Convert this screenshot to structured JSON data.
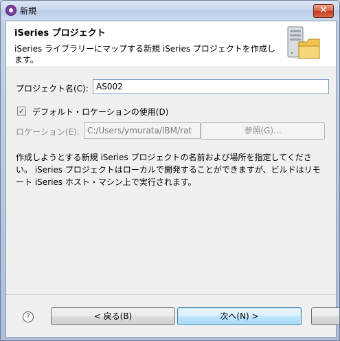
{
  "window": {
    "title": "新規",
    "close_label": "✕"
  },
  "header": {
    "title": "iSeries プロジェクト",
    "description": "iSeries ライブラリーにマップする新規 iSeries プロジェクトを作成します。"
  },
  "form": {
    "project_name_label": "プロジェクト名(C):",
    "project_name_value": "AS002",
    "use_default_location_label": "デフォルト・ロケーションの使用(D)",
    "use_default_location_checked": true,
    "location_label": "ロケーション(E):",
    "location_value": "C:/Users/ymurata/IBM/rat",
    "browse_label": "参照(G)..."
  },
  "description": "作成しようとする新規 iSeries プロジェクトの名前および場所を指定してください。 iSeries プロジェクトはローカルで開発することができますが、ビルドはリモート iSeries ホスト・マシン上で実行されます。",
  "footer": {
    "help_icon": "?",
    "back_label": "< 戻る(B)",
    "next_label": "次へ(N) >"
  },
  "colors": {
    "accent": "#3c7fb1",
    "dialog_bg": "#f0f0f0"
  }
}
